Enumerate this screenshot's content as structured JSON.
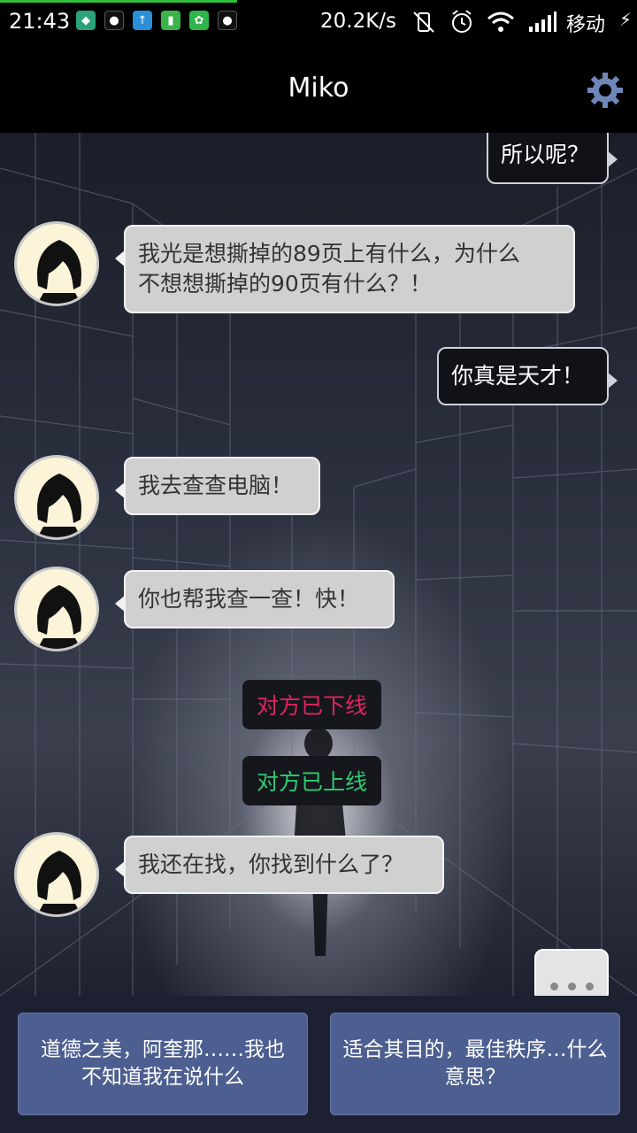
{
  "status_bar": {
    "time": "21:43",
    "net_speed": "20.2K/s",
    "carrier": "移动"
  },
  "header": {
    "title": "Miko"
  },
  "messages": [
    {
      "from": "me",
      "text": "所以呢？"
    },
    {
      "from": "miko",
      "text_line1": "我光是想撕掉的89页上有什么，为什么",
      "text_line2": "不想想撕掉的90页有什么？！"
    },
    {
      "from": "me",
      "text": "你真是天才！"
    },
    {
      "from": "miko",
      "text": "我去查查电脑！"
    },
    {
      "from": "miko",
      "text": "你也帮我查一查！快！"
    },
    {
      "from": "system",
      "text": "对方已下线",
      "color": "#e0245e"
    },
    {
      "from": "system",
      "text": "对方已上线",
      "color": "#2ecc71"
    },
    {
      "from": "miko",
      "text": "我还在找，你找到什么了？"
    }
  ],
  "choices": [
    {
      "label_line1": "道德之美，阿奎那……我也",
      "label_line2": "不知道我在说什么"
    },
    {
      "label_line1": "适合其目的，最佳秩序…什么",
      "label_line2": "意思？"
    }
  ],
  "colors": {
    "choice_bg": "#4d5f90",
    "offline": "#e0245e",
    "online": "#2ecc71"
  }
}
